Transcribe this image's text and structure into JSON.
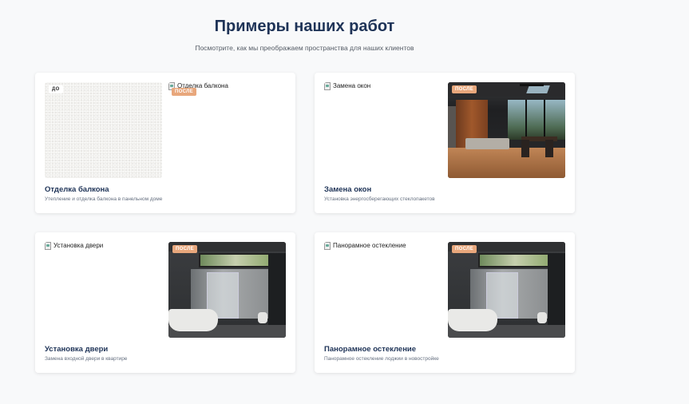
{
  "header": {
    "title": "Примеры наших работ",
    "subtitle": "Посмотрите, как мы преображаем пространства для наших клиентов"
  },
  "labels": {
    "before": "ДО",
    "after": "ПОСЛЕ"
  },
  "cards": [
    {
      "title": "Отделка балкона",
      "description": "Утепление и отделка балкона в панельном доме",
      "before_alt": "до",
      "after_alt": "Отделка балкона"
    },
    {
      "title": "Замена окон",
      "description": "Установка энергосберегающих стеклопакетов",
      "before_alt": "Замена окон",
      "after_alt": ""
    },
    {
      "title": "Установка двери",
      "description": "Замена входной двери в квартире",
      "before_alt": "Установка двери",
      "after_alt": ""
    },
    {
      "title": "Панорамное остекление",
      "description": "Панорамное остекление лоджии в новостройке",
      "before_alt": "Панорамное остекление",
      "after_alt": ""
    }
  ],
  "colors": {
    "heading": "#1e3357",
    "after_badge": "#e8a77c",
    "background": "#f8f9fa"
  }
}
